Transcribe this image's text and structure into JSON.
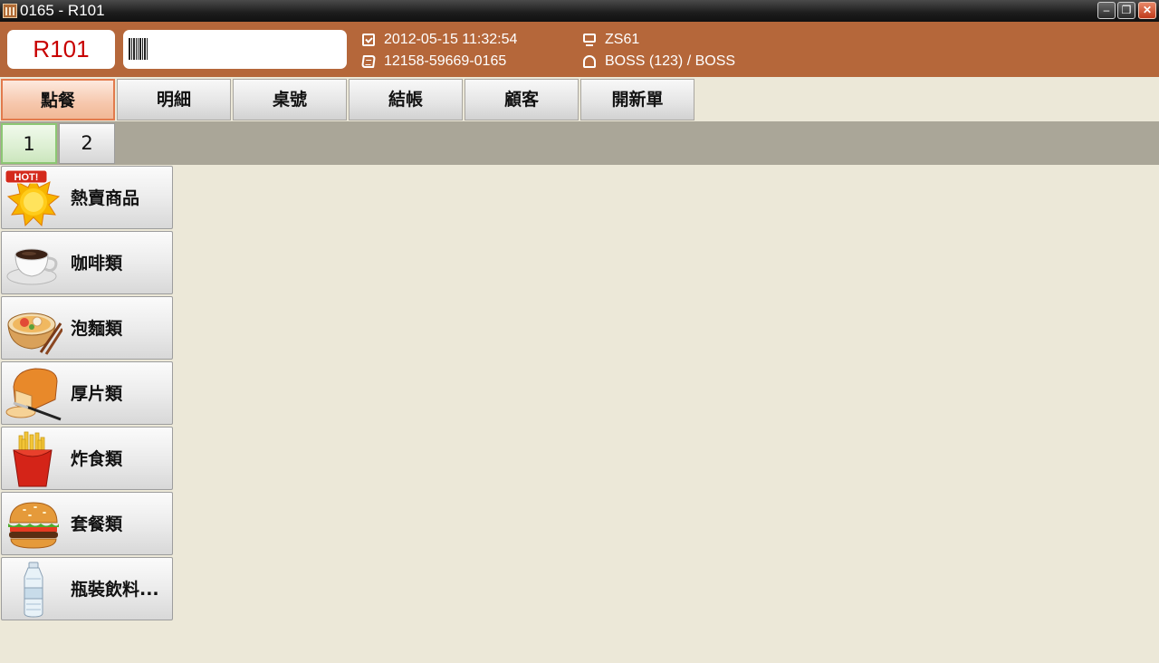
{
  "window": {
    "title": "0165 - R101",
    "minimize_glyph": "–",
    "maximize_glyph": "❐",
    "close_glyph": "✕"
  },
  "header": {
    "table_no": "R101",
    "barcode_value": "",
    "datetime": "2012-05-15 11:32:54",
    "order_no": "12158-59669-0165",
    "terminal": "ZS61",
    "user": "BOSS (123) / BOSS"
  },
  "tabs": [
    {
      "label": "點餐",
      "active": true
    },
    {
      "label": "明細"
    },
    {
      "label": "桌號"
    },
    {
      "label": "結帳"
    },
    {
      "label": "顧客"
    },
    {
      "label": "開新單"
    }
  ],
  "pages": [
    {
      "label": "1",
      "active": true
    },
    {
      "label": "2"
    }
  ],
  "categories": [
    {
      "label": "熱賣商品",
      "icon": "hot-sun-icon",
      "badge": "HOT!"
    },
    {
      "label": "咖啡類",
      "icon": "coffee-cup-icon"
    },
    {
      "label": "泡麵類",
      "icon": "noodle-bowl-icon"
    },
    {
      "label": "厚片類",
      "icon": "bread-loaf-icon"
    },
    {
      "label": "炸食類",
      "icon": "french-fries-icon"
    },
    {
      "label": "套餐類",
      "icon": "hamburger-icon"
    },
    {
      "label": "瓶裝飲料...",
      "icon": "water-bottle-icon"
    }
  ],
  "colors": {
    "header_bg": "#b5673a",
    "table_text": "#c80000",
    "active_tab_border": "#e27a4c",
    "active_page_border": "#8cc774",
    "content_bg": "#ece8d8"
  }
}
